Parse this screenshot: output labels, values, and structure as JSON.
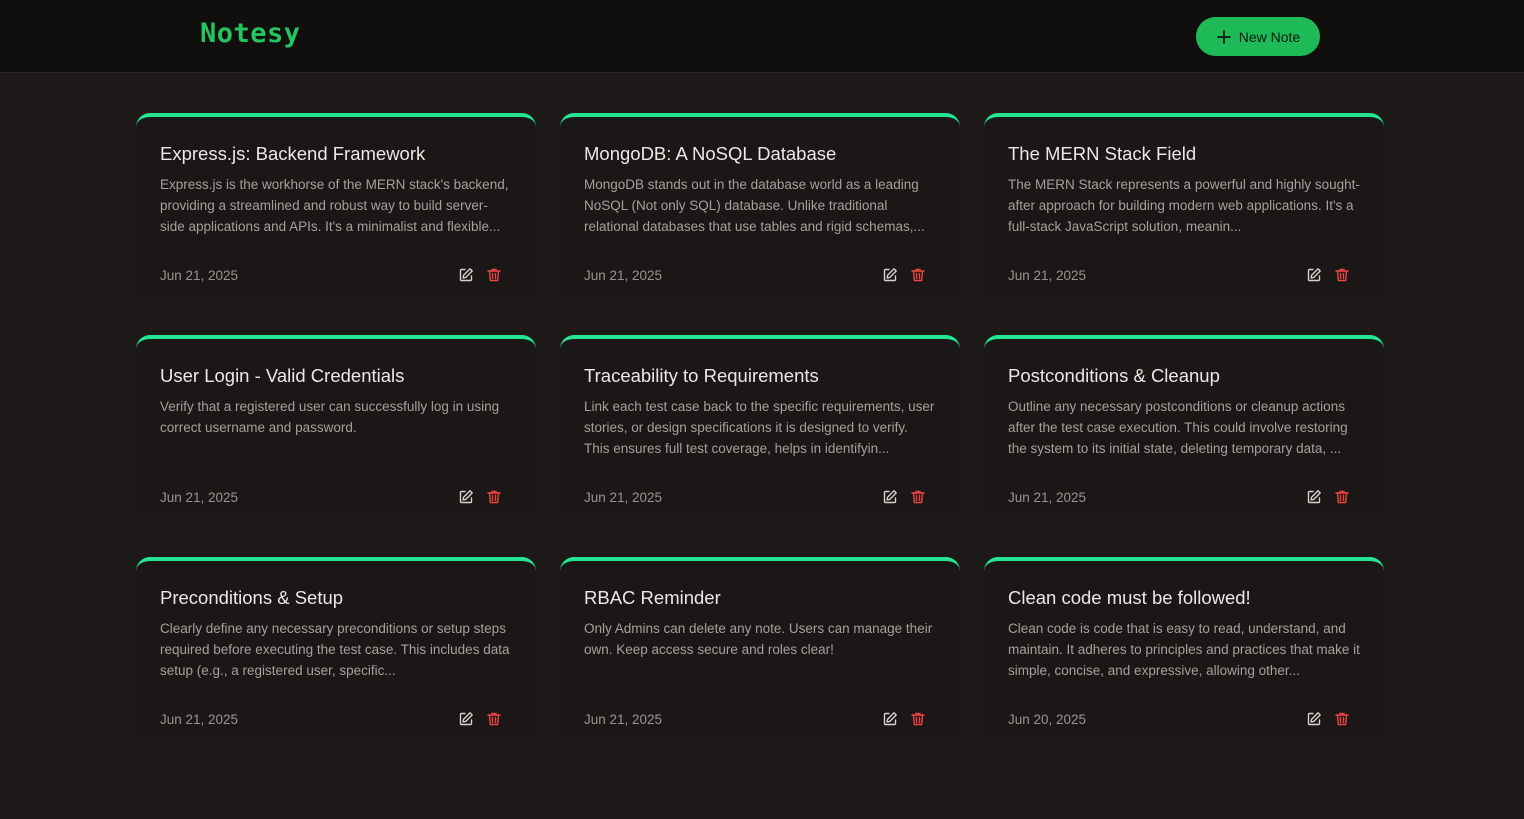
{
  "app": {
    "logo": "Notesy"
  },
  "header": {
    "new_note_label": "New Note",
    "new_note_icon": "plus-icon"
  },
  "colors": {
    "accent": "#22c55e",
    "card_border": "#25e592",
    "delete": "#ef4444"
  },
  "notes": [
    {
      "title": "Express.js: Backend Framework",
      "body": "Express.js is the workhorse of the MERN stack's backend, providing a streamlined and robust way to build server-side applications and APIs. It's a minimalist and flexible...",
      "date": "Jun 21, 2025"
    },
    {
      "title": "MongoDB: A NoSQL Database",
      "body": "MongoDB stands out in the database world as a leading NoSQL (Not only SQL) database. Unlike traditional relational databases that use tables and rigid schemas,...",
      "date": "Jun 21, 2025"
    },
    {
      "title": "The MERN Stack Field",
      "body": "The MERN Stack represents a powerful and highly sought-after approach for building modern web applications. It's a full-stack JavaScript solution, meanin...",
      "date": "Jun 21, 2025"
    },
    {
      "title": "User Login - Valid Credentials",
      "body": "Verify that a registered user can successfully log in using correct username and password.",
      "date": "Jun 21, 2025"
    },
    {
      "title": "Traceability to Requirements",
      "body": "Link each test case back to the specific requirements, user stories, or design specifications it is designed to verify. This ensures full test coverage, helps in identifyin...",
      "date": "Jun 21, 2025"
    },
    {
      "title": "Postconditions & Cleanup",
      "body": "Outline any necessary postconditions or cleanup actions after the test case execution. This could involve restoring the system to its initial state, deleting temporary data, ...",
      "date": "Jun 21, 2025"
    },
    {
      "title": "Preconditions & Setup",
      "body": "Clearly define any necessary preconditions or setup steps required before executing the test case. This includes data setup (e.g., a registered user, specific...",
      "date": "Jun 21, 2025"
    },
    {
      "title": "RBAC Reminder",
      "body": "Only Admins can delete any note. Users can manage their own. Keep access secure and roles clear!",
      "date": "Jun 21, 2025"
    },
    {
      "title": "Clean code must be followed!",
      "body": "Clean code is code that is easy to read, understand, and maintain. It adheres to principles and practices that make it simple, concise, and expressive, allowing other...",
      "date": "Jun 20, 2025"
    }
  ]
}
